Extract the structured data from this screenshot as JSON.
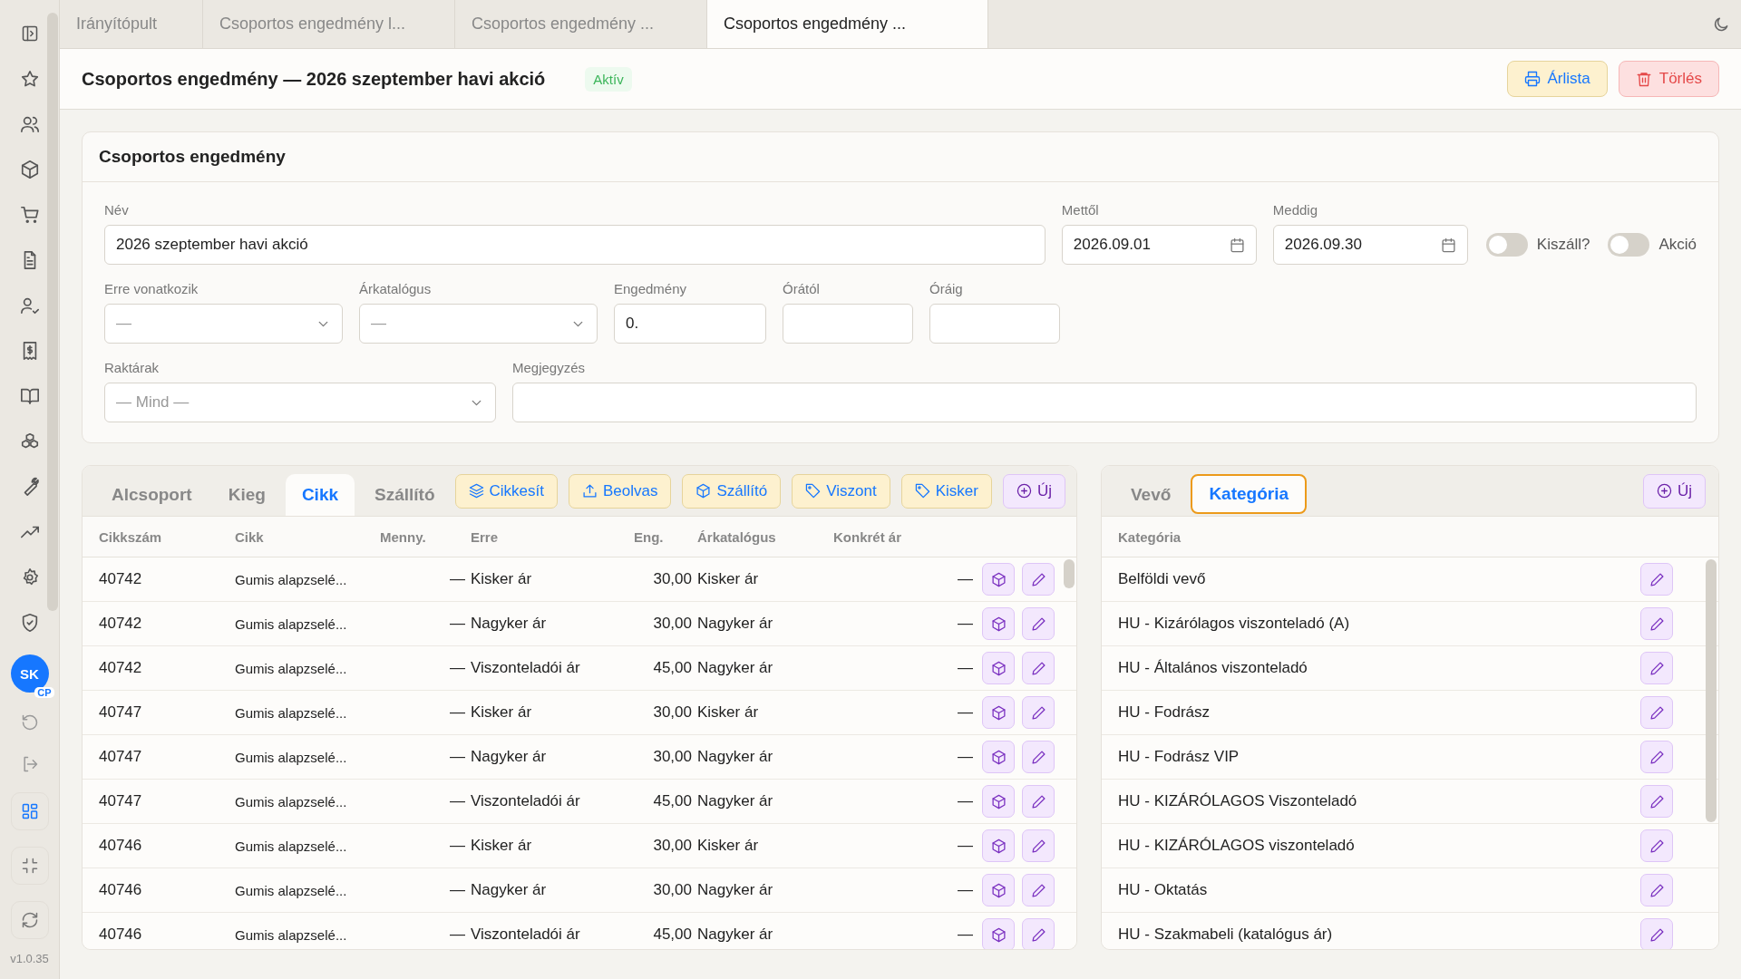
{
  "tabs": [
    {
      "label": "Irányítópult",
      "selected": false
    },
    {
      "label": "Csoportos engedmény l...",
      "selected": false
    },
    {
      "label": "Csoportos engedmény ...",
      "selected": false
    },
    {
      "label": "Csoportos engedmény ...",
      "selected": true
    }
  ],
  "sidebar": {
    "avatar": "SK",
    "avatar_badge": "CP",
    "tools": [
      {
        "selected": true
      },
      {
        "selected": false
      },
      {
        "selected": false
      }
    ],
    "version": "v1.0.35"
  },
  "header": {
    "title": "Csoportos engedmény — 2026 szeptember havi akció",
    "status": "Aktív",
    "buttons": [
      {
        "label": "Árlista",
        "kind": "print"
      },
      {
        "label": "Törlés",
        "kind": "delete"
      }
    ]
  },
  "form": {
    "title": "Csoportos engedmény",
    "name": {
      "label": "Név",
      "value": "2026 szeptember havi akció"
    },
    "from": {
      "label": "Mettől",
      "value": "2026.09.01"
    },
    "to": {
      "label": "Meddig",
      "value": "2026.09.30"
    },
    "toggles": [
      {
        "label": "Kiszáll?",
        "on": false
      },
      {
        "label": "Akció",
        "on": false
      }
    ],
    "applies_to": {
      "label": "Erre vonatkozik",
      "value": "—"
    },
    "catalog": {
      "label": "Árkatalógus",
      "value": "—"
    },
    "discount": {
      "label": "Engedmény",
      "value": "0."
    },
    "hour_from": {
      "label": "Órától"
    },
    "hour_to": {
      "label": "Óráig"
    },
    "warehouses": {
      "label": "Raktárak",
      "value": "— Mind —"
    },
    "note": {
      "label": "Megjegyzés"
    }
  },
  "items_panel": {
    "tabs": [
      {
        "label": "Alcsoport",
        "selected": false
      },
      {
        "label": "Kieg",
        "selected": false
      },
      {
        "label": "Cikk",
        "selected": true
      },
      {
        "label": "Szállító",
        "selected": false
      }
    ],
    "actions": [
      {
        "label": "Cikkesít",
        "kind": "layers"
      },
      {
        "label": "Beolvas",
        "kind": "upload"
      },
      {
        "label": "Szállító",
        "kind": "package"
      },
      {
        "label": "Viszont",
        "kind": "tag"
      },
      {
        "label": "Kisker",
        "kind": "tag"
      },
      {
        "label": "Új",
        "kind": "new"
      }
    ],
    "columns": [
      "Cikkszám",
      "Cikk",
      "Menny.",
      "Erre",
      "Eng.",
      "Árkatalógus",
      "Konkrét ár"
    ],
    "rows": [
      [
        "40742",
        "Gumis alapzselé...",
        "—",
        "Kisker ár",
        "30,00",
        "Kisker ár",
        "—"
      ],
      [
        "40742",
        "Gumis alapzselé...",
        "—",
        "Nagyker ár",
        "30,00",
        "Nagyker ár",
        "—"
      ],
      [
        "40742",
        "Gumis alapzselé...",
        "—",
        "Viszonteladói ár",
        "45,00",
        "Nagyker ár",
        "—"
      ],
      [
        "40747",
        "Gumis alapzselé...",
        "—",
        "Kisker ár",
        "30,00",
        "Kisker ár",
        "—"
      ],
      [
        "40747",
        "Gumis alapzselé...",
        "—",
        "Nagyker ár",
        "30,00",
        "Nagyker ár",
        "—"
      ],
      [
        "40747",
        "Gumis alapzselé...",
        "—",
        "Viszonteladói ár",
        "45,00",
        "Nagyker ár",
        "—"
      ],
      [
        "40746",
        "Gumis alapzselé...",
        "—",
        "Kisker ár",
        "30,00",
        "Kisker ár",
        "—"
      ],
      [
        "40746",
        "Gumis alapzselé...",
        "—",
        "Nagyker ár",
        "30,00",
        "Nagyker ár",
        "—"
      ],
      [
        "40746",
        "Gumis alapzselé...",
        "—",
        "Viszonteladói ár",
        "45,00",
        "Nagyker ár",
        "—"
      ]
    ]
  },
  "category_panel": {
    "tabs": [
      {
        "label": "Vevő",
        "selected": false
      },
      {
        "label": "Kategória",
        "selected": true
      }
    ],
    "new_button": "Új",
    "columns": [
      "Kategória"
    ],
    "rows": [
      "Belföldi vevő",
      "HU - Kizárólagos viszonteladó (A)",
      "HU - Általános viszonteladó",
      "HU - Fodrász",
      "HU - Fodrász VIP",
      "HU - KIZÁRÓLAGOS Viszonteladó",
      "HU - KIZÁRÓLAGOS viszonteladó",
      "HU - Oktatás",
      "HU - Szakmabeli (katalógus ár)"
    ]
  }
}
